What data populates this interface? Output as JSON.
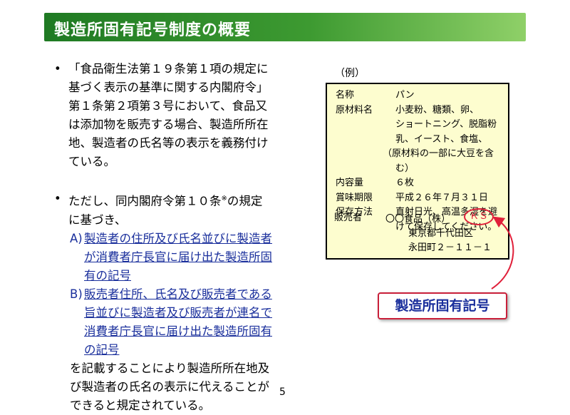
{
  "title": "製造所固有記号制度の概要",
  "bullets": {
    "b1": [
      "「食品衛生法第１９条第１項の規定に",
      "基づく表示の基準に関する内閣府令」",
      "第１条第２項第３号において、食品又",
      "は添加物を販売する場合、製造所所在",
      "地、製造者の氏名等の表示を義務付け",
      "ている。"
    ],
    "b2": [
      "ただし、同内閣府令第１０条",
      "※",
      "の規定",
      "に基づき、"
    ],
    "dot": "•",
    "a_label": "A)",
    "a": [
      "製造者の住所及び氏名並びに製造者",
      "が消費者庁長官に届け出た製造所固",
      "有の記号"
    ],
    "b_label": "B)",
    "b": [
      "販売者住所、氏名及び販売者である",
      "旨並びに製造者及び販売者が連名で",
      "消費者庁長官に届け出た製造所固有",
      "の記号"
    ],
    "after": [
      "を記載することにより製造所所在地及",
      "び製造者の氏名の表示に代えることが",
      "できると規定されている。"
    ]
  },
  "example": {
    "label": "（例）",
    "rows": {
      "name_key": "名称",
      "name_val": "パン",
      "ing_key": "原材料名",
      "ing_val": [
        "小麦粉、糖類、卵、",
        "ショートニング、脱脂粉",
        "乳、イースト、食塩、",
        "（原材料の一部に大豆を含",
        "む）"
      ],
      "qty_key": "内容量",
      "qty_val": "６枚",
      "exp_key": "賞味期限",
      "exp_val": "平成２６年７月３１日",
      "store_key": "保存方法",
      "store_val": [
        "直射日光、高温多湿を避",
        "けて保存してください。"
      ],
      "seller_key": "販売者",
      "seller_val": [
        "〇〇食品（株）",
        "東京都千代田区",
        "永田町２－１１－１"
      ],
      "ks": "ＫＳ"
    }
  },
  "callout": "製造所固有記号",
  "page_number": "5",
  "colors": {
    "title_green": "#2e8b2e",
    "link_blue": "#1a2f9c",
    "accent_red": "#e0203a",
    "label_bg": "#fdfdcf"
  }
}
